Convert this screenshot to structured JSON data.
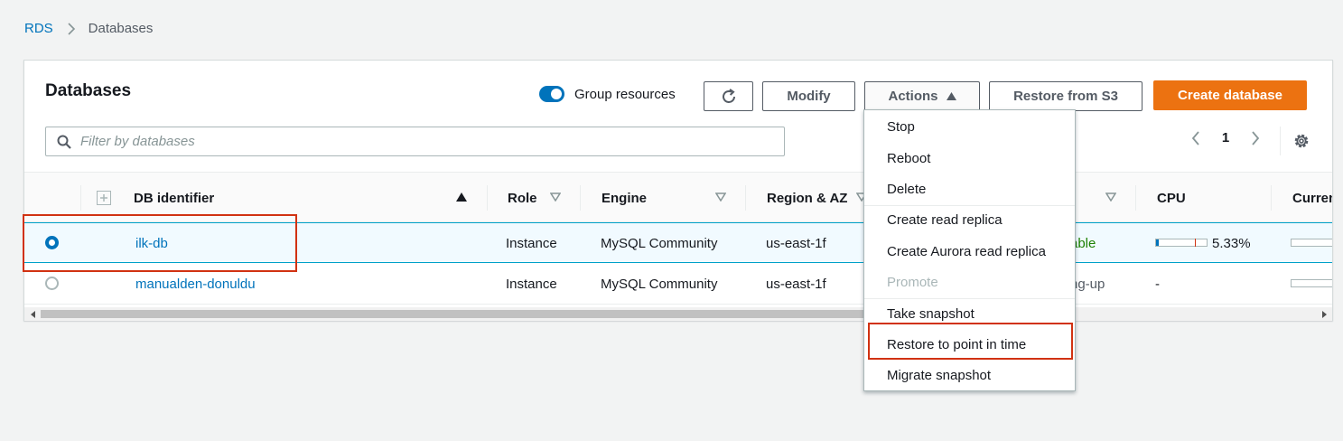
{
  "breadcrumb": {
    "root": "RDS",
    "current": "Databases"
  },
  "panel": {
    "title": "Databases"
  },
  "toolbar": {
    "group_toggle_label": "Group resources",
    "group_toggle_on": true,
    "refresh_icon": "refresh-icon",
    "modify_label": "Modify",
    "actions_label": "Actions",
    "restore_s3_label": "Restore from S3",
    "create_label": "Create database"
  },
  "filter": {
    "placeholder": "Filter by databases",
    "value": ""
  },
  "pagination": {
    "page": "1"
  },
  "table": {
    "columns": [
      "DB identifier",
      "Role",
      "Engine",
      "Region & AZ",
      "CPU",
      "Curren"
    ],
    "rows": [
      {
        "id": "ilk-db",
        "role": "Instance",
        "engine": "MySQL Community",
        "region": "us-east-1f",
        "status": "able",
        "cpu_text": "5.33%",
        "cpu_percent": 5.33,
        "selected": true
      },
      {
        "id": "manualden-donuldu",
        "role": "Instance",
        "engine": "MySQL Community",
        "region": "us-east-1f",
        "status": "ng-up",
        "cpu_text": "-",
        "selected": false
      }
    ]
  },
  "actions_menu": {
    "items": [
      {
        "label": "Stop",
        "enabled": true
      },
      {
        "label": "Reboot",
        "enabled": true
      },
      {
        "label": "Delete",
        "enabled": true
      },
      {
        "label": "Create read replica",
        "enabled": true
      },
      {
        "label": "Create Aurora read replica",
        "enabled": true
      },
      {
        "label": "Promote",
        "enabled": false
      },
      {
        "label": "Take snapshot",
        "enabled": true
      },
      {
        "label": "Restore to point in time",
        "enabled": true
      },
      {
        "label": "Migrate snapshot",
        "enabled": true
      }
    ]
  },
  "colors": {
    "accent": "#0073bb",
    "primary_button": "#ec7211",
    "highlight": "#d13212",
    "status_available": "#1d8102"
  }
}
